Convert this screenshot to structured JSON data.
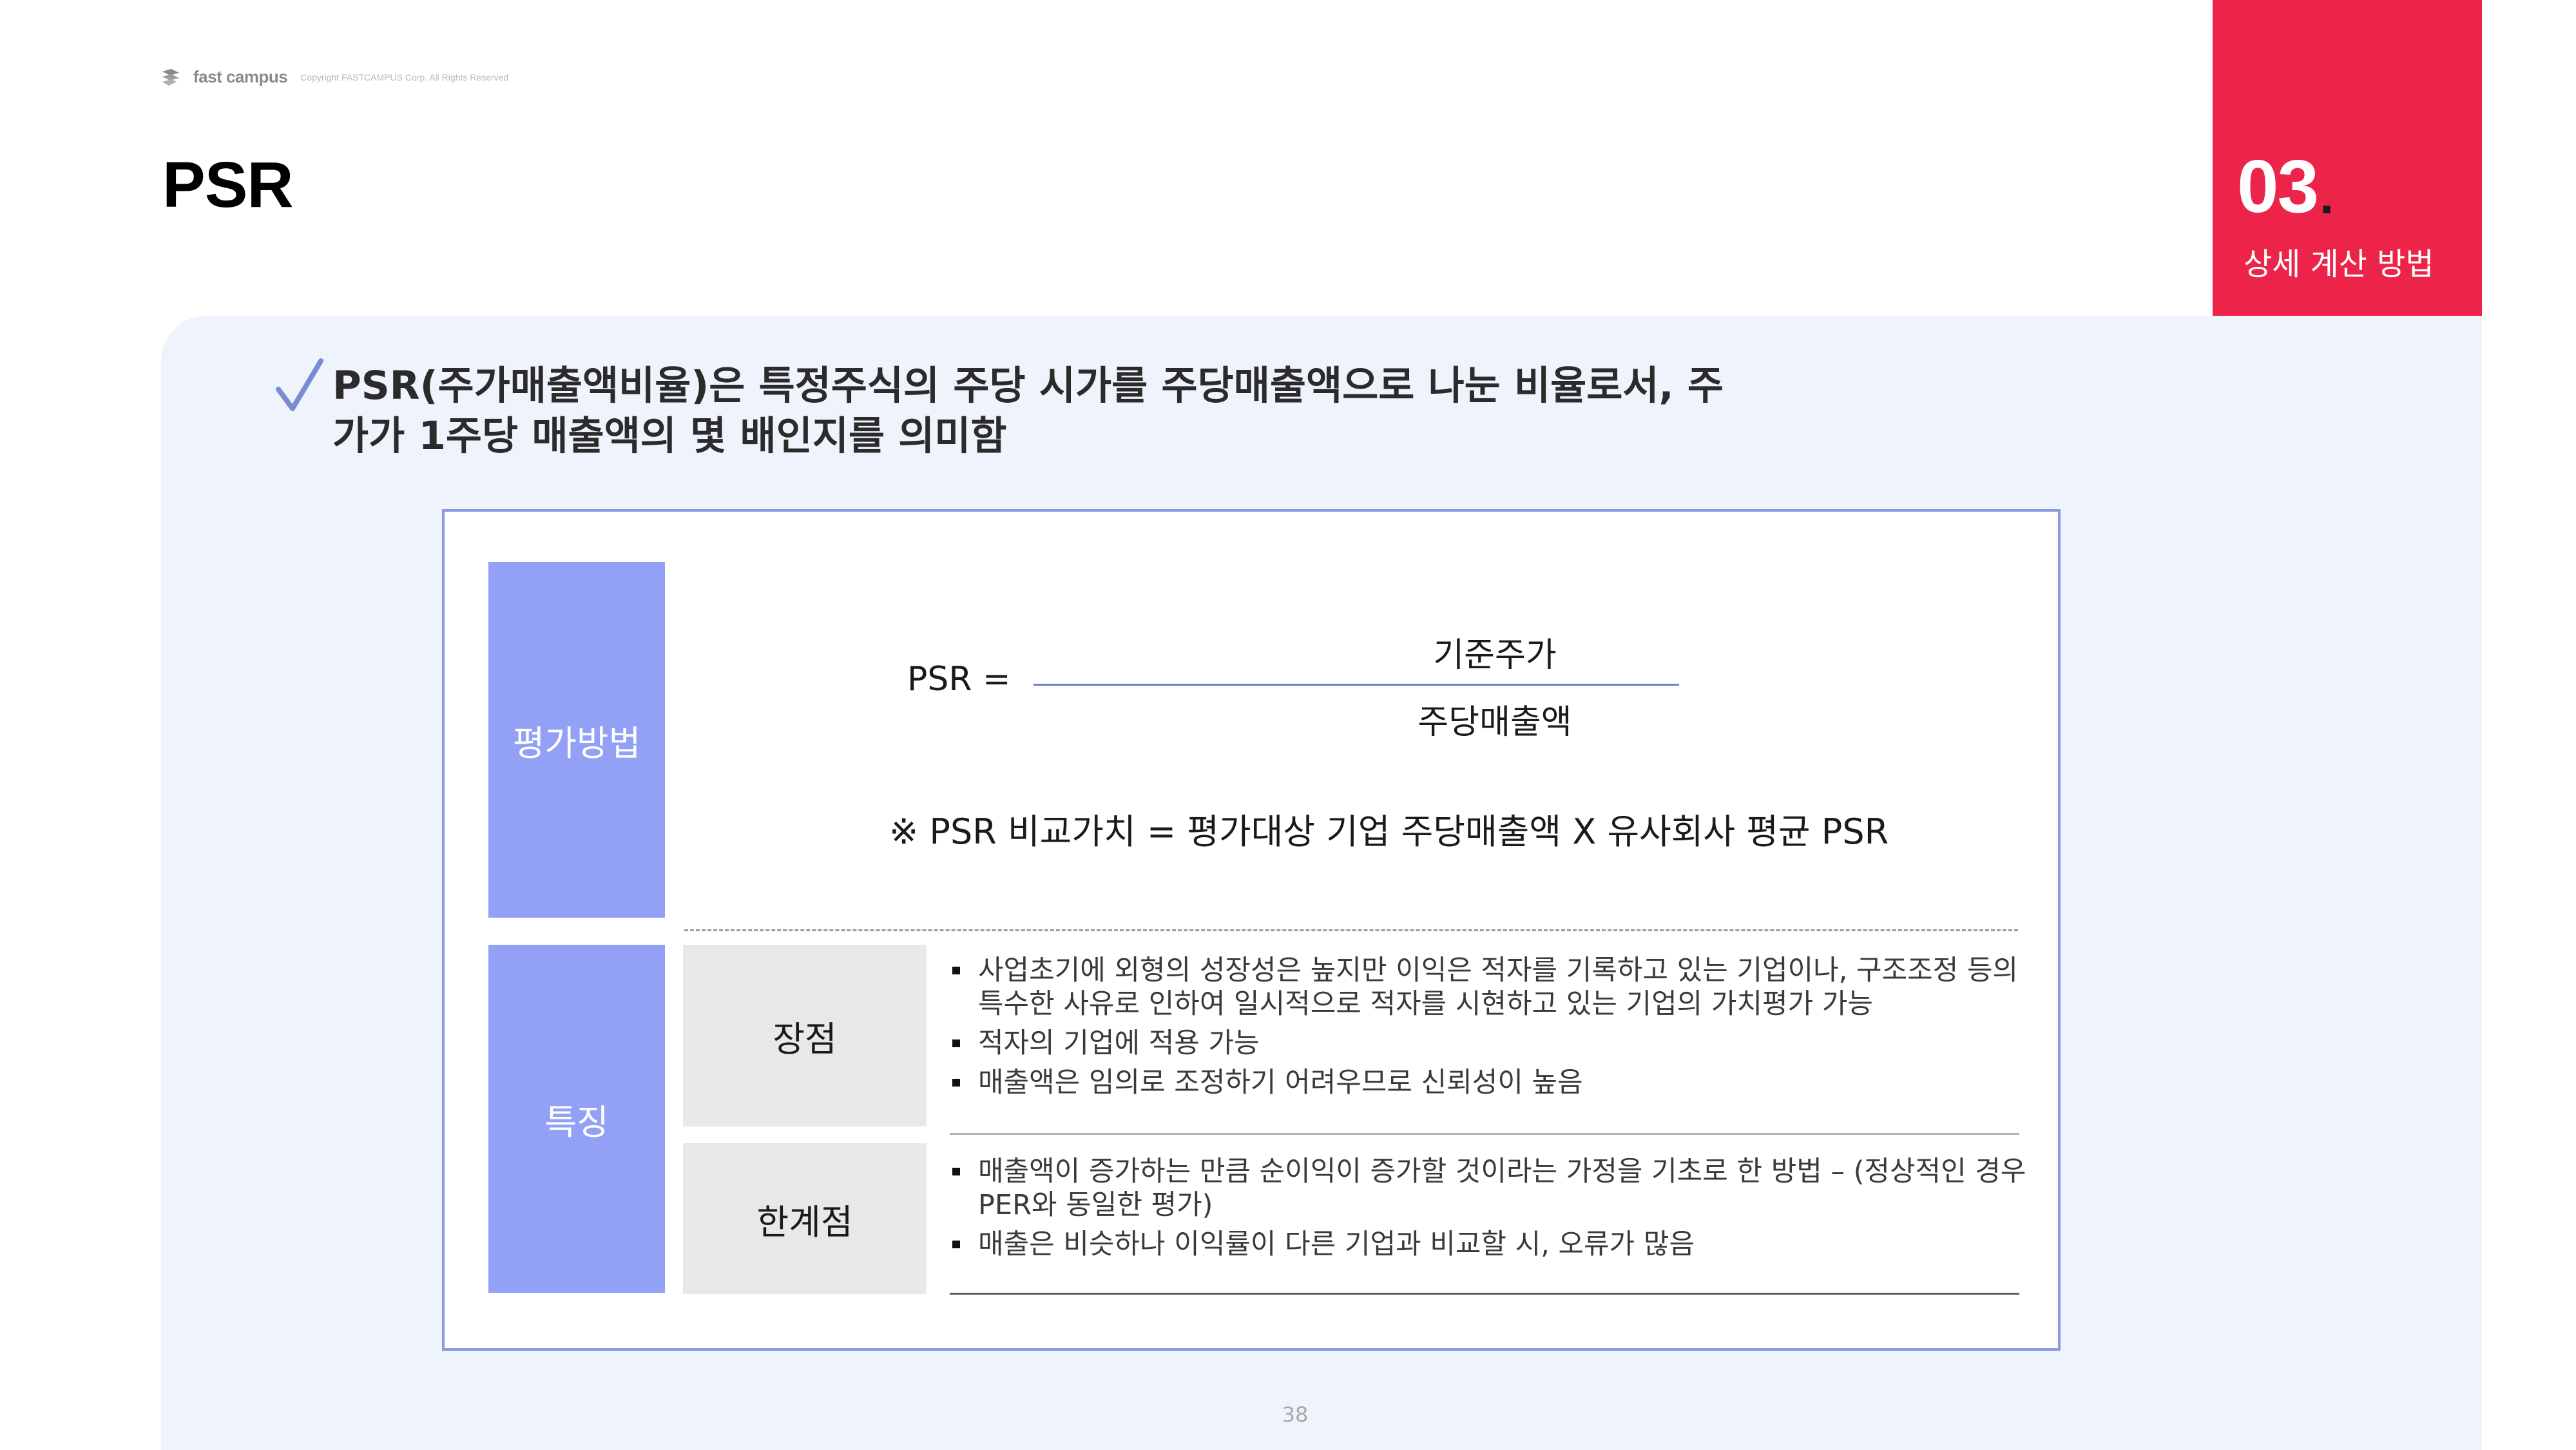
{
  "header": {
    "logo_text": "fast campus",
    "copyright": "Copyright FASTCAMPUS Corp. All Rights Reserved"
  },
  "title": "PSR",
  "section": {
    "number": "03",
    "dot": ".",
    "label": "상세 계산 방법",
    "accent_color": "#ec2449"
  },
  "headline": "PSR(주가매출액비율)은 특정주식의 주당 시가를 주당매출액으로 나눈 비율로서, 주가가 1주당 매출액의 몇 배인지를 의미함",
  "method": {
    "label": "평가방법",
    "formula_lhs": "PSR =",
    "numerator": "기준주가",
    "denominator": "주당매출액",
    "note": "※ PSR 비교가치  = 평가대상 기업 주당매출액 X 유사회사 평균 PSR"
  },
  "features": {
    "label": "특징",
    "pros": {
      "label": "장점",
      "items": [
        "사업초기에 외형의 성장성은 높지만 이익은 적자를 기록하고 있는 기업이나, 구조조정 등의 특수한 사유로 인하여 일시적으로 적자를 시현하고 있는 기업의 가치평가 가능",
        "적자의 기업에 적용 가능",
        "매출액은 임의로 조정하기 어려우므로 신뢰성이 높음"
      ]
    },
    "cons": {
      "label": "한계점",
      "items": [
        "매출액이 증가하는 만큼 순이익이 증가할 것이라는 가정을 기초로 한 방법 – (정상적인 경우 PER와 동일한 평가)",
        "매출은 비슷하나 이익률이 다른 기업과 비교할 시, 오류가 많음"
      ]
    }
  },
  "page_number": "38"
}
